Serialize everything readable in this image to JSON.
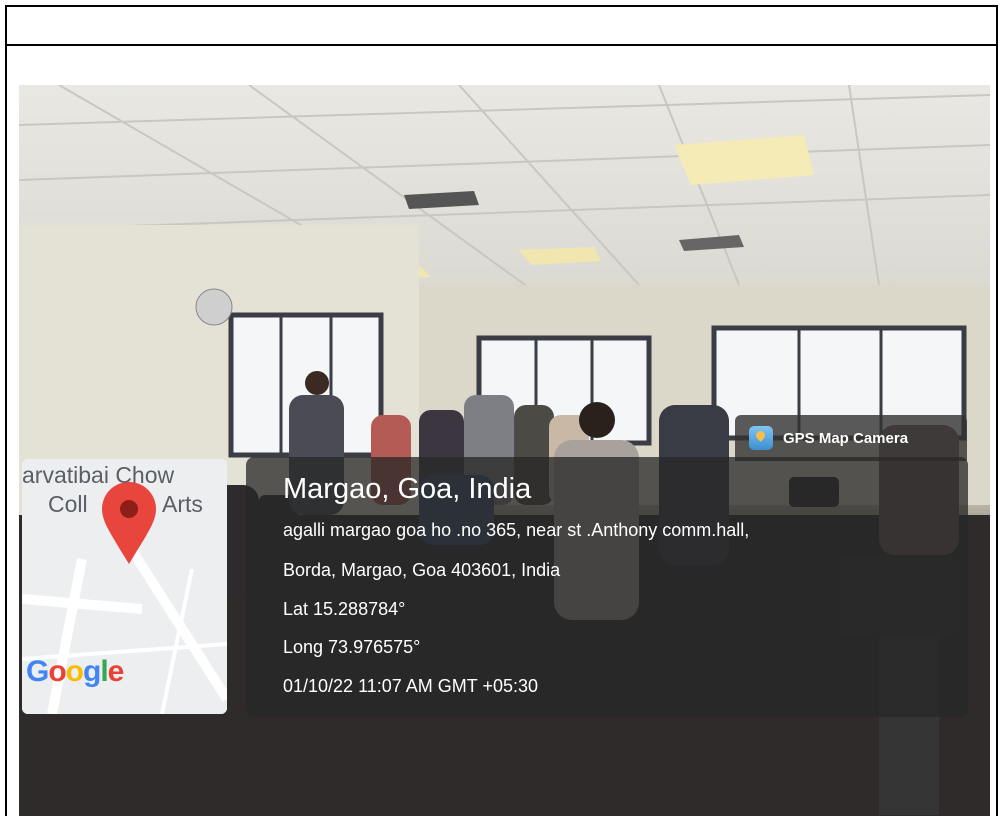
{
  "gps_overlay": {
    "app_label": "GPS Map Camera",
    "location_title": "Margao, Goa, India",
    "address_line1": "agalli margao goa ho .no 365, near st .Anthony comm.hall,",
    "address_line2": "Borda, Margao, Goa 403601, India",
    "latitude": "Lat 15.288784°",
    "longitude": "Long 73.976575°",
    "timestamp": "01/10/22 11:07 AM GMT +05:30"
  },
  "mini_map": {
    "place_label_part1": "arvatibai Chow",
    "place_label_part2": "Coll",
    "place_label_part3": "Arts",
    "brand": {
      "g1": "G",
      "o1": "o",
      "o2": "o",
      "g2": "g",
      "l": "l",
      "e": "e"
    },
    "marker_icon": "map-pin-icon",
    "marker_color": "#e8453c"
  },
  "colors": {
    "overlay_bg": "#2a2a2a",
    "text": "#ffffff"
  }
}
